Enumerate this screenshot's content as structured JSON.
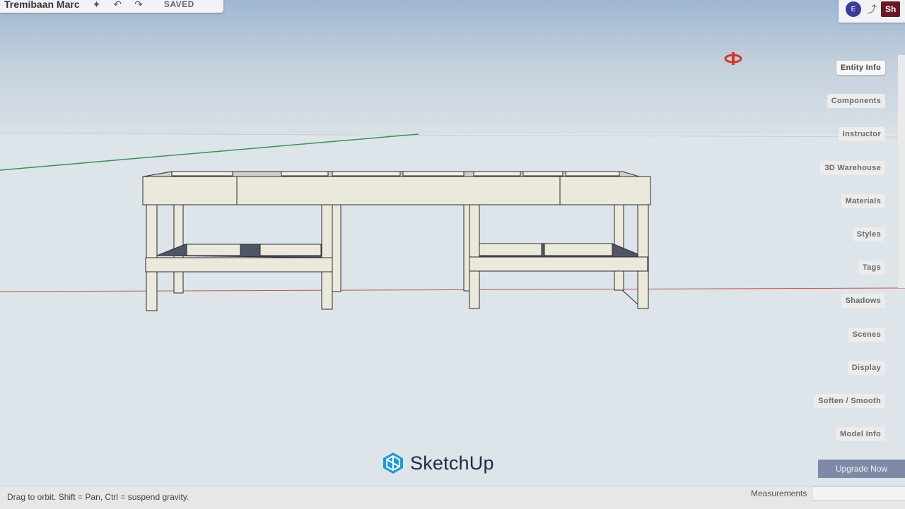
{
  "file": {
    "title": "Tremibaan Marc",
    "status": "SAVED"
  },
  "header": {
    "avatar_initial": "E",
    "share_label": "Sh"
  },
  "panel_tabs": [
    {
      "label": "Entity Info",
      "active": true
    },
    {
      "label": "Components"
    },
    {
      "label": "Instructor"
    },
    {
      "label": "3D Warehouse"
    },
    {
      "label": "Materials"
    },
    {
      "label": "Styles"
    },
    {
      "label": "Tags"
    },
    {
      "label": "Shadows"
    },
    {
      "label": "Scenes"
    },
    {
      "label": "Display"
    },
    {
      "label": "Soften / Smooth"
    },
    {
      "label": "Model Info"
    }
  ],
  "upgrade": {
    "label": "Upgrade Now"
  },
  "logo": {
    "text": "SketchUp"
  },
  "status_bar": {
    "hint": "Drag to orbit. Shift = Pan, Ctrl = suspend gravity.",
    "measurements_label": "Measurements",
    "measurements_value": ""
  },
  "colors": {
    "brand_logo": "#1f9ad6",
    "share_button": "#6b1726",
    "upgrade_button": "#7f8aa6",
    "red_axis": "#c0554f",
    "green_axis": "#3f8f56",
    "wood": "#ebe9dc"
  },
  "icons": [
    "undo-icon",
    "redo-icon",
    "sparkle-icon",
    "link-icon",
    "orbit-cursor-icon",
    "sketchup-logo-icon"
  ]
}
